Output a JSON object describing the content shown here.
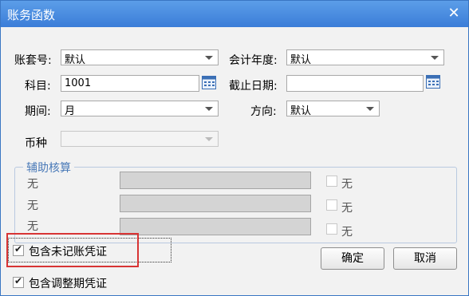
{
  "window": {
    "title": "账务函数",
    "close_glyph": "✕"
  },
  "form": {
    "account_set": {
      "label": "账套号:",
      "value": "默认"
    },
    "fiscal_year": {
      "label": "会计年度:",
      "value": "默认"
    },
    "subject": {
      "label": "科目:",
      "value": "1001"
    },
    "end_date": {
      "label": "截止日期:",
      "value": ""
    },
    "period": {
      "label": "期间:",
      "value": "月"
    },
    "direction": {
      "label": "方向:",
      "value": "默认"
    },
    "currency": {
      "label": "币种",
      "value": ""
    }
  },
  "aux": {
    "legend": "辅助核算",
    "rows": [
      {
        "label": "无",
        "check_label": "无"
      },
      {
        "label": "无",
        "check_label": "无"
      },
      {
        "label": "无",
        "check_label": "无"
      }
    ]
  },
  "options": {
    "include_unposted": {
      "label": "包含未记账凭证",
      "checked": true
    },
    "include_adjust": {
      "label": "包含调整期凭证",
      "checked": true
    }
  },
  "buttons": {
    "ok": "确定",
    "cancel": "取消"
  },
  "colors": {
    "titlebar": "#3b7dd8",
    "highlight_box": "#d83434"
  }
}
